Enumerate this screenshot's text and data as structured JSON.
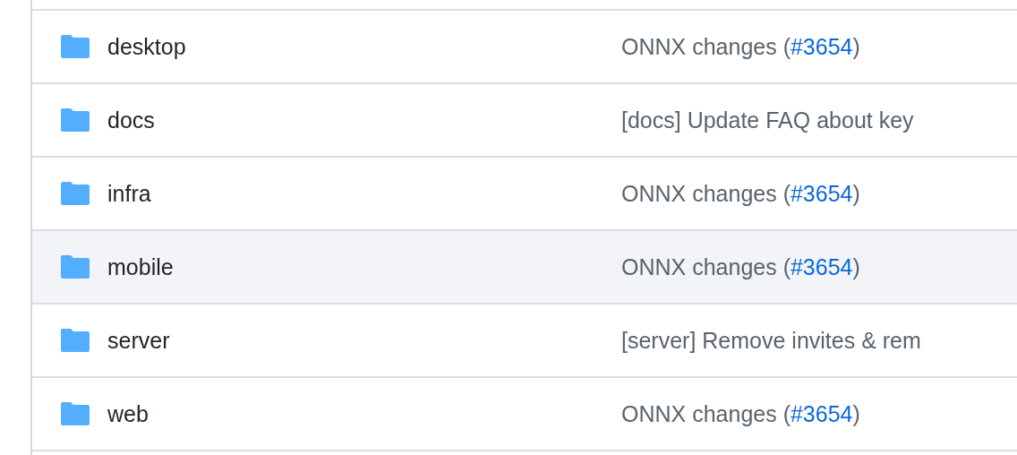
{
  "rows": [
    {
      "name": "desktop",
      "highlighted": false,
      "message": {
        "text": "ONNX changes (",
        "link": "#3654",
        "after": ")"
      }
    },
    {
      "name": "docs",
      "highlighted": false,
      "message": {
        "text": "[docs] Update FAQ about key"
      }
    },
    {
      "name": "infra",
      "highlighted": false,
      "message": {
        "text": "ONNX changes (",
        "link": "#3654",
        "after": ")"
      }
    },
    {
      "name": "mobile",
      "highlighted": true,
      "message": {
        "text": "ONNX changes (",
        "link": "#3654",
        "after": ")"
      }
    },
    {
      "name": "server",
      "highlighted": false,
      "message": {
        "text": "[server] Remove invites & rem"
      }
    },
    {
      "name": "web",
      "highlighted": false,
      "message": {
        "text": "ONNX changes (",
        "link": "#3654",
        "after": ")"
      }
    }
  ]
}
